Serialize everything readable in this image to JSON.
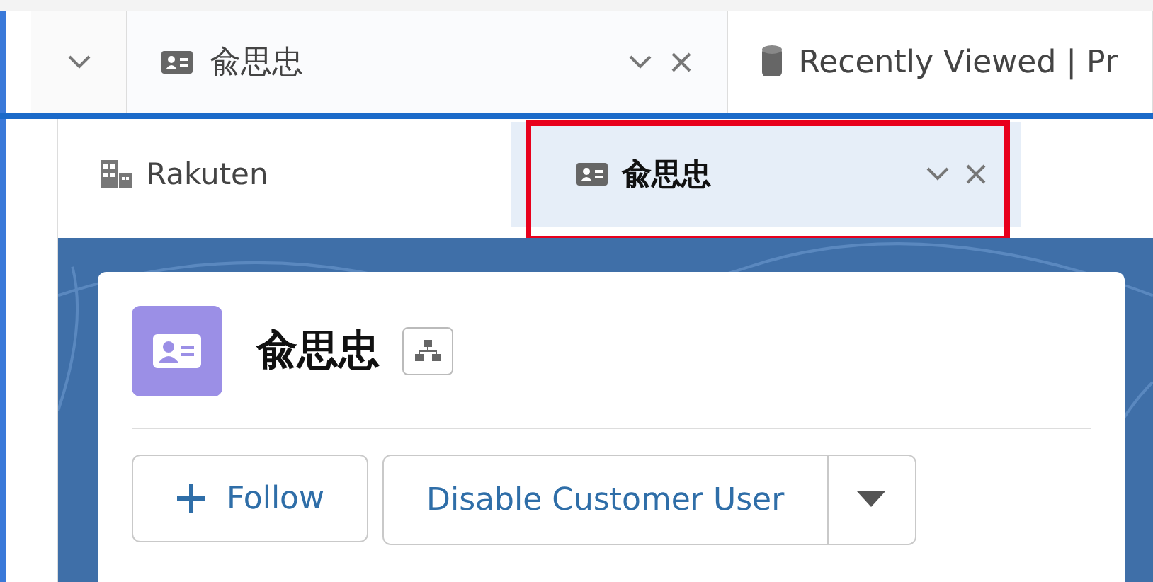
{
  "workspace_tabs": [
    {
      "label": "兪思忠",
      "kind": "contact",
      "closable": true,
      "selected": true
    },
    {
      "label": "Recently Viewed | Pr",
      "kind": "cylinder",
      "closable": false,
      "selected": false
    }
  ],
  "subtabs": [
    {
      "label": "Rakuten",
      "kind": "building",
      "closable": false,
      "selected": false
    },
    {
      "label": "兪思忠",
      "kind": "contact",
      "closable": true,
      "selected": true
    }
  ],
  "highlight": {
    "on": true
  },
  "record": {
    "title": "兪思忠",
    "actions": [
      {
        "kind": "follow",
        "label": "Follow"
      },
      {
        "kind": "group",
        "label": "Disable Customer User"
      }
    ]
  }
}
